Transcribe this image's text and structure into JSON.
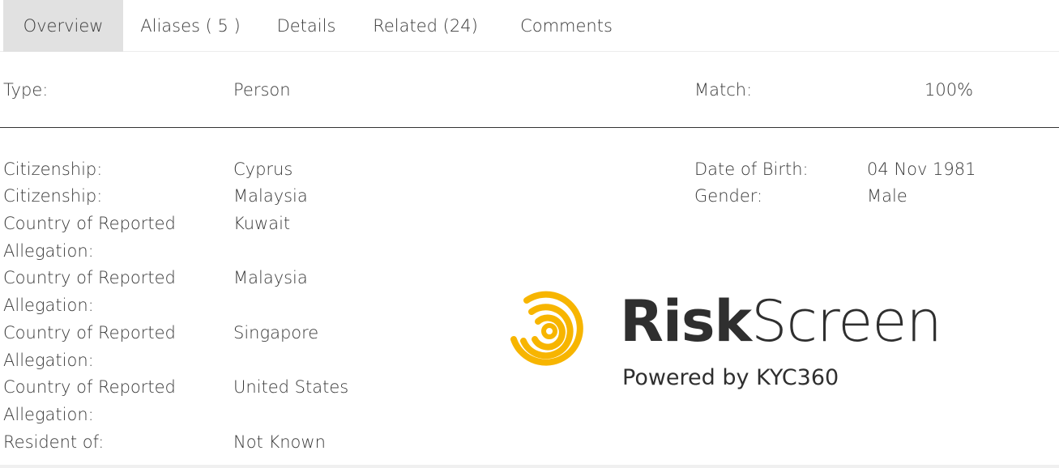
{
  "tabs": [
    {
      "label": "Overview",
      "active": true
    },
    {
      "label": "Aliases ( 5 )",
      "active": false
    },
    {
      "label": "Details",
      "active": false
    },
    {
      "label": "Related (24)",
      "active": false
    },
    {
      "label": "Comments",
      "active": false
    }
  ],
  "summary": {
    "type_label": "Type:",
    "type_value": "Person",
    "match_label": "Match:",
    "match_value": "100%"
  },
  "left_fields": [
    {
      "label": "Citizenship:",
      "value": "Cyprus"
    },
    {
      "label": "Citizenship:",
      "value": "Malaysia"
    },
    {
      "label_line1": "Country of Reported",
      "label_line2": "Allegation:",
      "value": "Kuwait"
    },
    {
      "label_line1": "Country of Reported",
      "label_line2": "Allegation:",
      "value": "Malaysia"
    },
    {
      "label_line1": "Country of Reported",
      "label_line2": "Allegation:",
      "value": "Singapore"
    },
    {
      "label_line1": "Country of Reported",
      "label_line2": "Allegation:",
      "value": "United States"
    },
    {
      "label": "Resident of:",
      "value": "Not Known"
    }
  ],
  "right_fields": [
    {
      "label": "Date of Birth:",
      "value": "04 Nov 1981"
    },
    {
      "label": "Gender:",
      "value": "Male"
    }
  ],
  "watermark": {
    "name_bold": "Risk",
    "name_light": "Screen",
    "tagline": "Powered by KYC360",
    "icon": "fingerprint-rings-icon",
    "accent_color": "#F7B500"
  }
}
